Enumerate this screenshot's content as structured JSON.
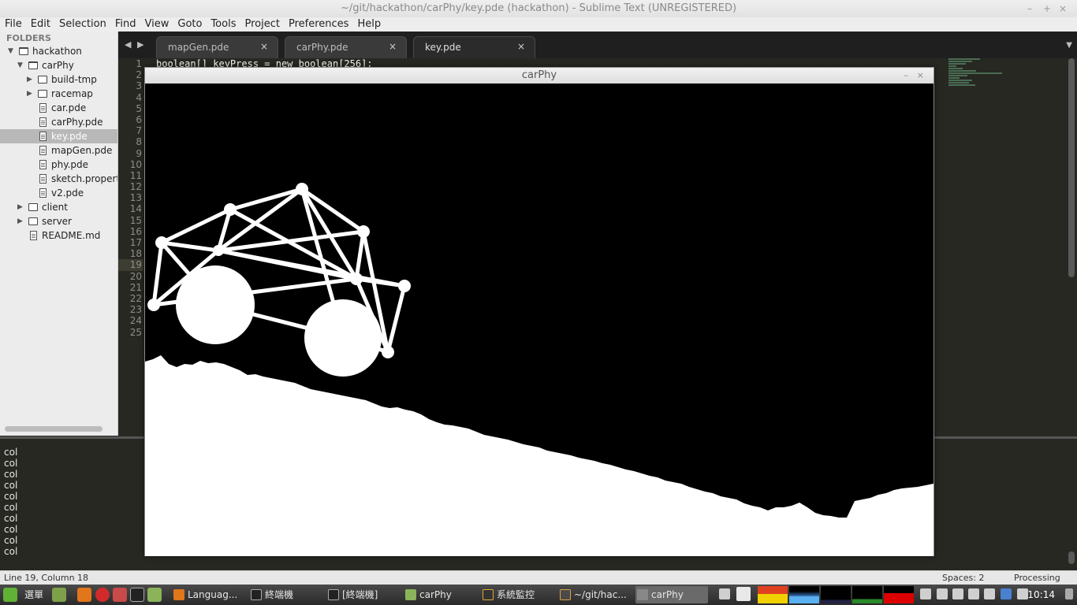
{
  "window_title": "~/git/hackathon/carPhy/key.pde (hackathon) - Sublime Text (UNREGISTERED)",
  "window_controls": {
    "minimize": "–",
    "maximize": "+",
    "close": "×"
  },
  "menu": [
    "File",
    "Edit",
    "Selection",
    "Find",
    "View",
    "Goto",
    "Tools",
    "Project",
    "Preferences",
    "Help"
  ],
  "sidebar": {
    "header": "FOLDERS",
    "items": [
      {
        "label": "hackathon",
        "kind": "folder-open",
        "level": 0
      },
      {
        "label": "carPhy",
        "kind": "folder-open",
        "level": 1
      },
      {
        "label": "build-tmp",
        "kind": "folder",
        "level": 2
      },
      {
        "label": "racemap",
        "kind": "folder",
        "level": 2
      },
      {
        "label": "car.pde",
        "kind": "file",
        "level": 2
      },
      {
        "label": "carPhy.pde",
        "kind": "file",
        "level": 2
      },
      {
        "label": "key.pde",
        "kind": "file",
        "level": 2,
        "selected": true
      },
      {
        "label": "mapGen.pde",
        "kind": "file",
        "level": 2
      },
      {
        "label": "phy.pde",
        "kind": "file",
        "level": 2
      },
      {
        "label": "sketch.properties",
        "kind": "file",
        "level": 2
      },
      {
        "label": "v2.pde",
        "kind": "file",
        "level": 2
      },
      {
        "label": "client",
        "kind": "folder",
        "level": 1
      },
      {
        "label": "server",
        "kind": "folder",
        "level": 1
      },
      {
        "label": "README.md",
        "kind": "file",
        "level": 1
      }
    ]
  },
  "tabs": [
    {
      "label": "mapGen.pde",
      "active": false
    },
    {
      "label": "carPhy.pde",
      "active": false
    },
    {
      "label": "key.pde",
      "active": true
    }
  ],
  "tab_close_glyph": "×",
  "editor": {
    "line_numbers": [
      "1",
      "2",
      "3",
      "4",
      "5",
      "6",
      "7",
      "8",
      "9",
      "10",
      "11",
      "12",
      "13",
      "14",
      "15",
      "16",
      "17",
      "18",
      "19",
      "20",
      "21",
      "22",
      "23",
      "24",
      "25"
    ],
    "highlight_line": 19,
    "visible_code": "boolean[] keyPress = new boolean[256];"
  },
  "console_lines": [
    "col",
    "col",
    "col",
    "col",
    "col",
    "col",
    "col",
    "col",
    "col",
    "col"
  ],
  "status": {
    "position": "Line 19, Column 18",
    "spaces": "Spaces: 2",
    "syntax": "Processing"
  },
  "sketch_window": {
    "title": "carPhy",
    "minimize": "–",
    "close": "×"
  },
  "taskbar": {
    "menu_label": "選單",
    "buttons": [
      {
        "label": "Languag...",
        "icon": "firefox-icon"
      },
      {
        "label": "終端機",
        "icon": "terminal-icon"
      },
      {
        "label": "[終端機]",
        "icon": "terminal-icon"
      },
      {
        "label": "carPhy",
        "icon": "folder-icon"
      },
      {
        "label": "系統監控",
        "icon": "monitor-icon"
      },
      {
        "label": "~/git/hac...",
        "icon": "sublime-icon"
      },
      {
        "label": "carPhy",
        "icon": "processing-icon",
        "active": true
      }
    ],
    "clock": "10:14"
  },
  "colors": {
    "editor_bg": "#272822",
    "sidebar_bg": "#ececec",
    "terrain": "#ffffff",
    "canvas_bg": "#000000"
  }
}
